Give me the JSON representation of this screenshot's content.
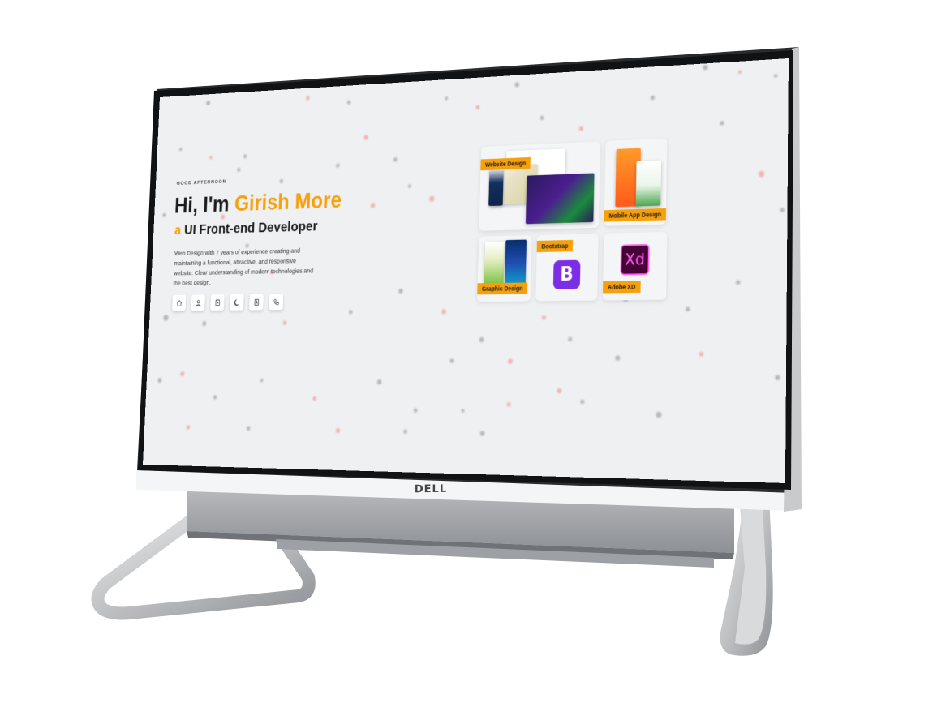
{
  "brand": {
    "device_logo": "DELL"
  },
  "hero": {
    "greeting": "GOOD AFTERNOON",
    "intro_prefix": "Hi, I'm ",
    "name": "Girish More",
    "role_prefix": "a ",
    "role": "UI Front-end Developer",
    "description": "Web Design with 7 years of experience creating and maintaining a functional, attractive, and responsive website. Clear understanding of modern technologies and the best design.",
    "accent_color": "#f6a00b"
  },
  "social_links": [
    {
      "icon": "home-icon"
    },
    {
      "icon": "user-icon"
    },
    {
      "icon": "document-icon"
    },
    {
      "icon": "moon-icon"
    },
    {
      "icon": "file-icon"
    },
    {
      "icon": "phone-icon"
    }
  ],
  "skills": {
    "website_design": "Website Design",
    "mobile_app_design": "Mobile App Design",
    "graphic_design": "Graphic Design",
    "bootstrap": "Bootstrap",
    "bootstrap_logo": "B",
    "adobe_xd": "Adobe XD",
    "adobe_xd_logo": "Xd"
  }
}
